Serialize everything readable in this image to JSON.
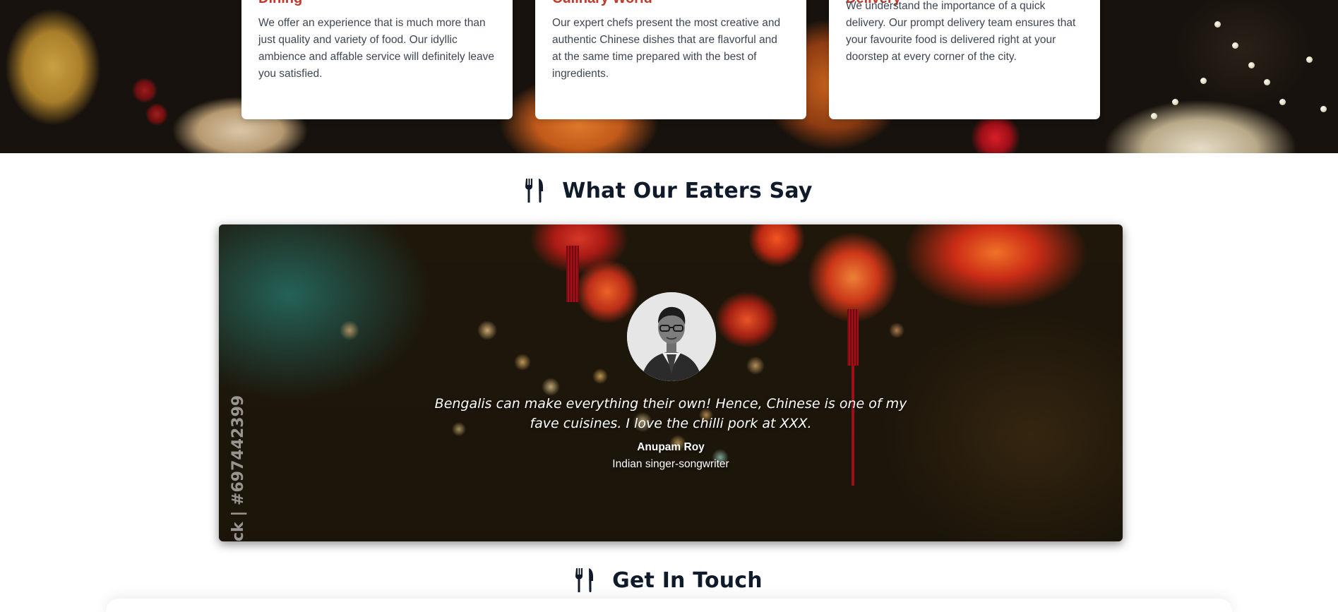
{
  "features": [
    {
      "title": "Dining",
      "text": "We offer an experience that is much more than just quality and variety of food. Our idyllic ambience and affable service will definitely leave you satisfied."
    },
    {
      "title": "Culinary World",
      "text": "Our expert chefs present the most creative and authentic Chinese dishes that are flavorful and at the same time prepared with the best of ingredients."
    },
    {
      "title": "Delivery",
      "text": "We understand the importance of a quick delivery. Our prompt delivery team ensures that your favourite food is delivered right at your doorstep at every corner of the city."
    }
  ],
  "testimonials": {
    "heading": "What Our Eaters Say",
    "watermark": "ck | #697442399",
    "quote": "Bengalis can make everything their own! Hence, Chinese is one of my fave cuisines. I love the chilli pork at XXX.",
    "author": "Anupam Roy",
    "role": "Indian singer-songwriter"
  },
  "contact": {
    "heading": "Get In Touch"
  },
  "icons": {
    "section_icon": "utensils-icon",
    "avatar": "avatar"
  },
  "colors": {
    "heading": "#0f1a2b",
    "card_title": "#c0392b",
    "card_text": "#3f4652"
  }
}
